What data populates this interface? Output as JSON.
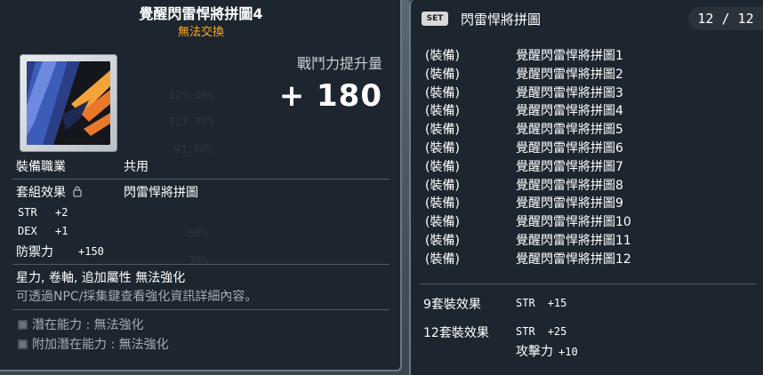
{
  "background": {
    "ghost_lines": [
      "120.00%",
      "127.00%",
      "91.00%",
      "50%",
      "30%"
    ]
  },
  "item": {
    "title": "覺醒閃雷悍將拼圖4",
    "trade_note": "無法交換",
    "icon": "puzzle-piece-icon",
    "combat_power_label": "戰鬥力提升量",
    "combat_power_value": "+ 180",
    "job_label": "裝備職業",
    "job_value": "共用",
    "set_label": "套組效果",
    "set_value": "閃雷悍將拼圖",
    "stats": [
      {
        "name": "STR",
        "value": "+2"
      },
      {
        "name": "DEX",
        "value": "+1"
      }
    ],
    "defense_label": "防禦力",
    "defense_value": "+150",
    "enhance_note": "星力, 卷軸, 追加屬性 無法強化",
    "info_note": "可透過NPC/採集鍵查看強化資訊詳細內容。",
    "potential": "潛在能力 : 無法強化",
    "bonus_potential": "附加潛在能力 : 無法強化"
  },
  "set": {
    "badge": "SET",
    "name": "閃雷悍將拼圖",
    "count": "12 / 12",
    "items": [
      {
        "category": "(裝備)",
        "name": "覺醒閃雷悍將拼圖1"
      },
      {
        "category": "(裝備)",
        "name": "覺醒閃雷悍將拼圖2"
      },
      {
        "category": "(裝備)",
        "name": "覺醒閃雷悍將拼圖3"
      },
      {
        "category": "(裝備)",
        "name": "覺醒閃雷悍將拼圖4"
      },
      {
        "category": "(裝備)",
        "name": "覺醒閃雷悍將拼圖5"
      },
      {
        "category": "(裝備)",
        "name": "覺醒閃雷悍將拼圖6"
      },
      {
        "category": "(裝備)",
        "name": "覺醒閃雷悍將拼圖7"
      },
      {
        "category": "(裝備)",
        "name": "覺醒閃雷悍將拼圖8"
      },
      {
        "category": "(裝備)",
        "name": "覺醒閃雷悍將拼圖9"
      },
      {
        "category": "(裝備)",
        "name": "覺醒閃雷悍將拼圖10"
      },
      {
        "category": "(裝備)",
        "name": "覺醒閃雷悍將拼圖11"
      },
      {
        "category": "(裝備)",
        "name": "覺醒閃雷悍將拼圖12"
      }
    ],
    "bonuses": [
      {
        "label": "9套裝效果",
        "stats": [
          {
            "name": "STR",
            "value": "+15"
          }
        ]
      },
      {
        "label": "12套裝效果",
        "stats": [
          {
            "name": "STR",
            "value": "+25"
          },
          {
            "name": "攻擊力",
            "value": "+10"
          }
        ]
      }
    ]
  },
  "colors": {
    "panel_bg": "#1c242c",
    "trade_note": "#ffaa22",
    "border": "#6c7884"
  }
}
